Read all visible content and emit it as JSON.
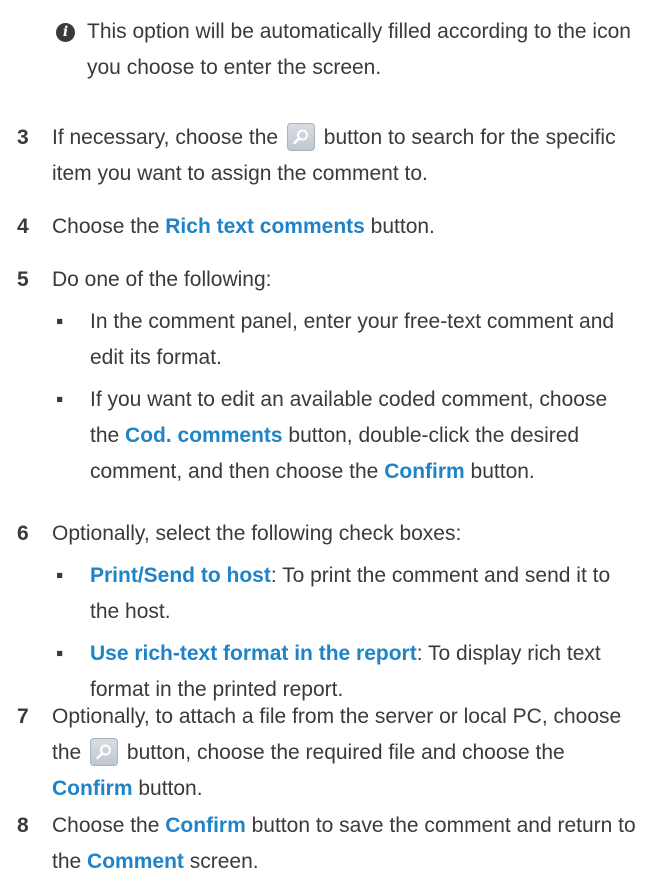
{
  "note": {
    "text": "This option will be automatically filled according to the icon you choose to enter the screen."
  },
  "steps": [
    {
      "number": "3",
      "part1": "If necessary, choose the",
      "part2": "button to search for the specific item you want to assign the comment to."
    },
    {
      "number": "4",
      "part1": "Choose the",
      "hl1": "Rich text comments",
      "part2": "button."
    },
    {
      "number": "5",
      "text": "Do one of the following:",
      "bullets": [
        {
          "text": "In the comment panel, enter your free-text comment and edit its format."
        },
        {
          "part1": "If you want to edit an available coded comment, choose the",
          "hl1": "Cod. comments",
          "part2": "button, double-click the desired comment, and then choose the",
          "hl2": "Confirm",
          "part3": "button."
        }
      ]
    },
    {
      "number": "6",
      "text": "Optionally, select the following check boxes:",
      "bullets": [
        {
          "hl": "Print/Send to host",
          "rest": ": To print the comment and send it to the host."
        },
        {
          "hl": "Use rich-text format in the report",
          "rest": ": To display rich text format in the printed report."
        }
      ]
    },
    {
      "number": "7",
      "part1": "Optionally, to attach a file from the server or local PC, choose the",
      "part2": "button, choose the required file and choose the",
      "hl1": "Confirm",
      "part3": "button."
    },
    {
      "number": "8",
      "part1": "Choose the",
      "hl1": "Confirm",
      "part2": "button to save the comment and return to the",
      "hl2": "Comment",
      "part3": "screen."
    }
  ],
  "colors": {
    "highlight": "#1f83c8",
    "text": "#3a3a3a"
  },
  "icons": {
    "note": "info-icon",
    "search": "magnifier-icon",
    "bullet": "square-bullet"
  }
}
